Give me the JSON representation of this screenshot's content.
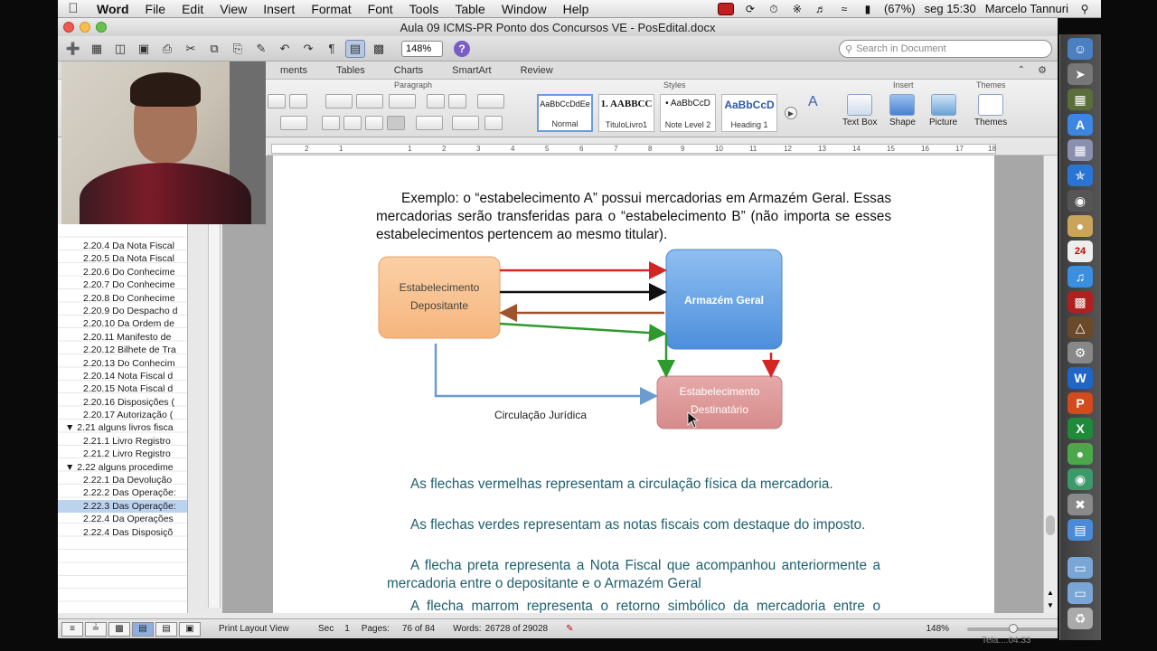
{
  "menubar": {
    "app_name": "Word",
    "items": [
      "File",
      "Edit",
      "View",
      "Insert",
      "Format",
      "Font",
      "Tools",
      "Table",
      "Window",
      "Help"
    ],
    "battery": "(67%)",
    "clock": "seg 15:30",
    "user": "Marcelo Tannuri"
  },
  "window": {
    "title": "Aula 09 ICMS-PR Ponto dos Concursos VE - PosEdital.docx",
    "zoom": "148%",
    "search_placeholder": "Search in Document"
  },
  "ribbon": {
    "tabs": [
      "ments",
      "Tables",
      "Charts",
      "SmartArt",
      "Review"
    ],
    "group_paragraph": "Paragraph",
    "group_styles": "Styles",
    "group_insert": "Insert",
    "group_themes": "Themes",
    "styles": [
      {
        "sample": "AaBbCcDdEe",
        "name": "Normal"
      },
      {
        "sample": "1. AABBCC",
        "name": "TituloLivro1"
      },
      {
        "sample": "• AaBbCcD",
        "name": "Note Level 2"
      },
      {
        "sample": "AaBbCcD",
        "name": "Heading 1"
      }
    ],
    "insert_buttons": [
      "Text Box",
      "Shape",
      "Picture"
    ],
    "themes_button": "Themes"
  },
  "ruler_numbers": [
    "2",
    "1",
    "1",
    "2",
    "3",
    "4",
    "5",
    "6",
    "7",
    "8",
    "9",
    "10",
    "11",
    "12",
    "13",
    "14",
    "15",
    "16",
    "17",
    "18"
  ],
  "sidebar": {
    "items": [
      {
        "label": "2.20.4 Da Nota Fiscal",
        "parent": false
      },
      {
        "label": "2.20.5 Da Nota Fiscal",
        "parent": false
      },
      {
        "label": "2.20.6 Do Conhecime",
        "parent": false
      },
      {
        "label": "2.20.7 Do Conhecime",
        "parent": false
      },
      {
        "label": "2.20.8 Do Conhecime",
        "parent": false
      },
      {
        "label": "2.20.9 Do Despacho d",
        "parent": false
      },
      {
        "label": "2.20.10 Da Ordem de",
        "parent": false
      },
      {
        "label": "2.20.11 Manifesto de",
        "parent": false
      },
      {
        "label": "2.20.12 Bilhete de Tra",
        "parent": false
      },
      {
        "label": "2.20.13 Do Conhecim",
        "parent": false
      },
      {
        "label": "2.20.14 Nota Fiscal d",
        "parent": false
      },
      {
        "label": "2.20.15 Nota Fiscal d",
        "parent": false
      },
      {
        "label": "2.20.16 Disposições (",
        "parent": false
      },
      {
        "label": "2.20.17 Autorização (",
        "parent": false
      },
      {
        "label": "▼ 2.21 alguns livros fisca",
        "parent": true
      },
      {
        "label": "2.21.1 Livro Registro",
        "parent": false
      },
      {
        "label": "2.21.2 Livro Registro",
        "parent": false
      },
      {
        "label": "▼ 2.22 alguns procedime",
        "parent": true
      },
      {
        "label": "2.22.1 Da Devolução",
        "parent": false
      },
      {
        "label": "2.22.2 Das Operaçõe:",
        "parent": false
      },
      {
        "label": "2.22.3 Das Operaçõe:",
        "parent": false,
        "selected": true
      },
      {
        "label": "2.22.4 Da Operações",
        "parent": false
      },
      {
        "label": "2.22.4 Das Disposiçõ",
        "parent": false
      }
    ]
  },
  "document": {
    "example_paragraph": "Exemplo: o “estabelecimento A” possui mercadorias em Armazém Geral. Essas mercadorias serão transferidas para o “estabelecimento B” (não importa se esses estabelecimentos pertencem ao mesmo titular).",
    "diagram": {
      "box_depositante": [
        "Estabelecimento",
        "Depositante"
      ],
      "box_armazem": "Armazém Geral",
      "box_destinatario": [
        "Estabelecimento",
        "Destinatário"
      ],
      "label_circulacao": "Circulação Jurídica",
      "colors": {
        "red": "#d42424",
        "black": "#111111",
        "brown": "#a0522d",
        "green": "#2e9a2e",
        "blue": "#6b9bd1"
      }
    },
    "p_red": "As flechas vermelhas representam a circulação física da mercadoria.",
    "p_green": "As flechas verdes representam as notas fiscais com destaque do imposto.",
    "p_black": "A flecha preta representa a Nota Fiscal que acompanhou anteriormente a mercadoria entre o depositante e o Armazém Geral",
    "p_brown": "A flecha marrom representa o retorno simbólico da mercadoria entre o Armazém Geral e o estabelecimento depositante."
  },
  "statusbar": {
    "view": "Print Layout View",
    "sec_label": "Sec",
    "sec_value": "1",
    "pages_label": "Pages:",
    "pages_value": "76 of 84",
    "words_label": "Words:",
    "words_value": "26728 of 29028",
    "zoom": "148%"
  },
  "watermark": "Tela....04.33"
}
